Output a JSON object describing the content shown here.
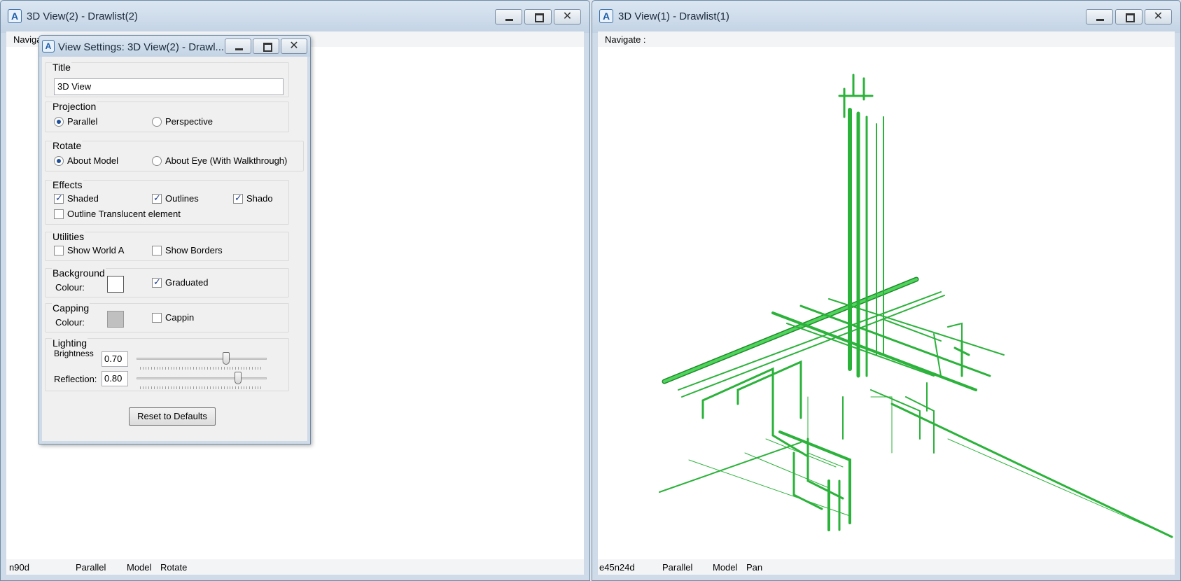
{
  "left_window": {
    "title": "3D View(2) - Drawlist(2)",
    "nav_label": "Navigate :",
    "status": {
      "direction": "n90d",
      "projection": "Parallel",
      "rotate_mode": "Model",
      "action": "Rotate"
    }
  },
  "right_window": {
    "title": "3D View(1) - Drawlist(1)",
    "nav_label": "Navigate :",
    "status": {
      "direction": "e45n24d",
      "projection": "Parallel",
      "rotate_mode": "Model",
      "action": "Pan"
    },
    "model_color": "#2bb23a"
  },
  "dialog": {
    "title": "View Settings: 3D View(2) - Drawl...",
    "title_group": {
      "label": "Title",
      "value": "3D View"
    },
    "projection": {
      "label": "Projection",
      "option1": "Parallel",
      "option2": "Perspective",
      "selected": "Parallel"
    },
    "rotate": {
      "label": "Rotate",
      "option1": "About Model",
      "option2": "About Eye (With Walkthrough)",
      "selected": "About Model"
    },
    "effects": {
      "label": "Effects",
      "shaded": "Shaded",
      "outlines": "Outlines",
      "shadows": "Shado",
      "outline_translucent": "Outline  Translucent  element"
    },
    "utilities": {
      "label": "Utilities",
      "show_world": "Show  World  A",
      "show_borders": "Show Borders"
    },
    "background": {
      "label": "Background",
      "colour_label": "Colour:",
      "graduated": "Graduated",
      "colour": "#ffffff"
    },
    "capping": {
      "label": "Capping",
      "colour_label": "Colour:",
      "capping": "Cappin",
      "colour": "#c0c0c0"
    },
    "lighting": {
      "label": "Lighting",
      "brightness_label": "Brightness",
      "brightness": "0.70",
      "reflection_label": "Reflection:",
      "reflection": "0.80"
    },
    "reset_button": "Reset to Defaults"
  },
  "icons": {
    "app": "aveva-app-icon",
    "minimize": "minimize-icon",
    "maximize": "maximize-icon",
    "close": "close-icon"
  }
}
